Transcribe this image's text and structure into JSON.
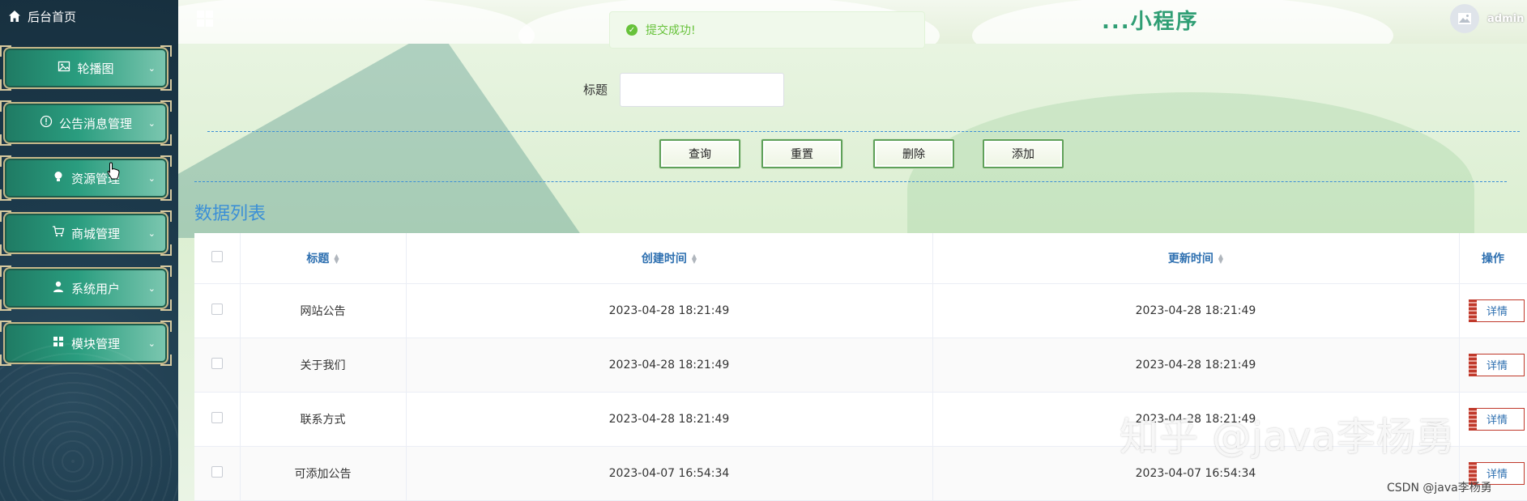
{
  "sidebar": {
    "home": "后台首页",
    "items": [
      {
        "label": "轮播图",
        "icon": "image-icon"
      },
      {
        "label": "公告消息管理",
        "icon": "info-icon"
      },
      {
        "label": "资源管理",
        "icon": "bulb-icon"
      },
      {
        "label": "商城管理",
        "icon": "cart-icon"
      },
      {
        "label": "系统用户",
        "icon": "user-icon"
      },
      {
        "label": "模块管理",
        "icon": "grid-icon"
      }
    ]
  },
  "header": {
    "title": "...小程序",
    "user": "admin"
  },
  "toast": {
    "message": "提交成功!",
    "color": "#67c23a"
  },
  "search": {
    "label": "标题",
    "value": "",
    "placeholder": ""
  },
  "actions": {
    "search": "查询",
    "reset": "重置",
    "delete": "删除",
    "add": "添加"
  },
  "list": {
    "title": "数据列表",
    "columns": [
      "标题",
      "创建时间",
      "更新时间",
      "操作"
    ],
    "rows": [
      {
        "title": "网站公告",
        "created": "2023-04-28 18:21:49",
        "updated": "2023-04-28 18:21:49",
        "action": "详情"
      },
      {
        "title": "关于我们",
        "created": "2023-04-28 18:21:49",
        "updated": "2023-04-28 18:21:49",
        "action": "详情"
      },
      {
        "title": "联系方式",
        "created": "2023-04-28 18:21:49",
        "updated": "2023-04-28 18:21:49",
        "action": "详情"
      },
      {
        "title": "可添加公告",
        "created": "2023-04-07 16:54:34",
        "updated": "2023-04-07 16:54:34",
        "action": "详情"
      }
    ]
  },
  "watermark": {
    "big": "知乎 @java李杨勇",
    "small": "CSDN @java李杨勇"
  },
  "colors": {
    "accent": "#3b8fd6",
    "menu": "#2a9d7f",
    "sidebar": "#1d3a4c"
  }
}
